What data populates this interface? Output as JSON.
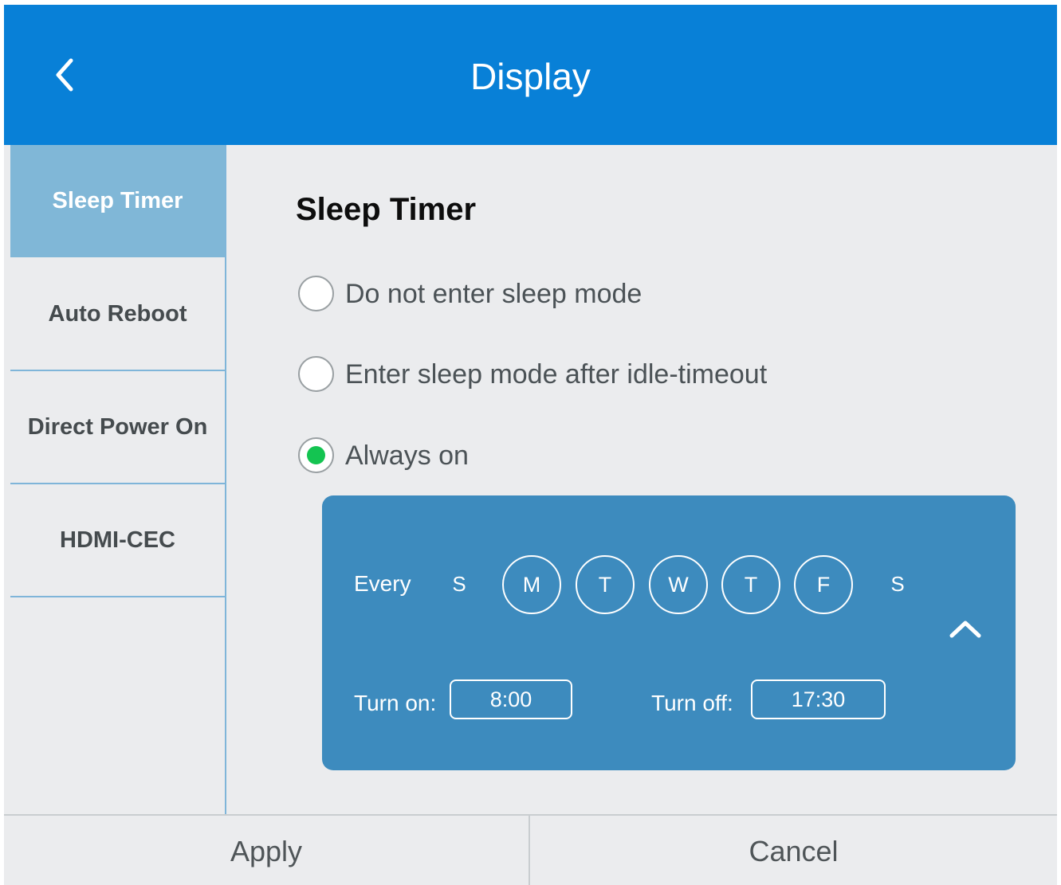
{
  "header": {
    "title": "Display",
    "back_icon": "chevron-left-icon",
    "background_color": "#0880d7"
  },
  "sidebar": {
    "items": [
      {
        "label": "Sleep Timer",
        "active": true
      },
      {
        "label": "Auto Reboot",
        "active": false
      },
      {
        "label": "Direct Power On",
        "active": false
      },
      {
        "label": "HDMI-CEC",
        "active": false
      }
    ],
    "active_color": "#80b7d7"
  },
  "main": {
    "section_title": "Sleep Timer",
    "options": [
      {
        "label": "Do not enter sleep mode",
        "selected": false
      },
      {
        "label": "Enter sleep mode after idle-timeout",
        "selected": false
      },
      {
        "label": "Always on",
        "selected": true
      }
    ],
    "selected_color": "#14c451"
  },
  "schedule": {
    "every_label": "Every",
    "days": [
      {
        "label": "S",
        "selected": false
      },
      {
        "label": "M",
        "selected": true
      },
      {
        "label": "T",
        "selected": true
      },
      {
        "label": "W",
        "selected": true
      },
      {
        "label": "T",
        "selected": true
      },
      {
        "label": "F",
        "selected": true
      },
      {
        "label": "S",
        "selected": false
      }
    ],
    "collapse_icon": "chevron-up-icon",
    "turn_on_label": "Turn on:",
    "turn_on_value": "8:00",
    "turn_off_label": "Turn off:",
    "turn_off_value": "17:30",
    "card_color": "#3d8bbe"
  },
  "footer": {
    "apply_label": "Apply",
    "cancel_label": "Cancel"
  }
}
